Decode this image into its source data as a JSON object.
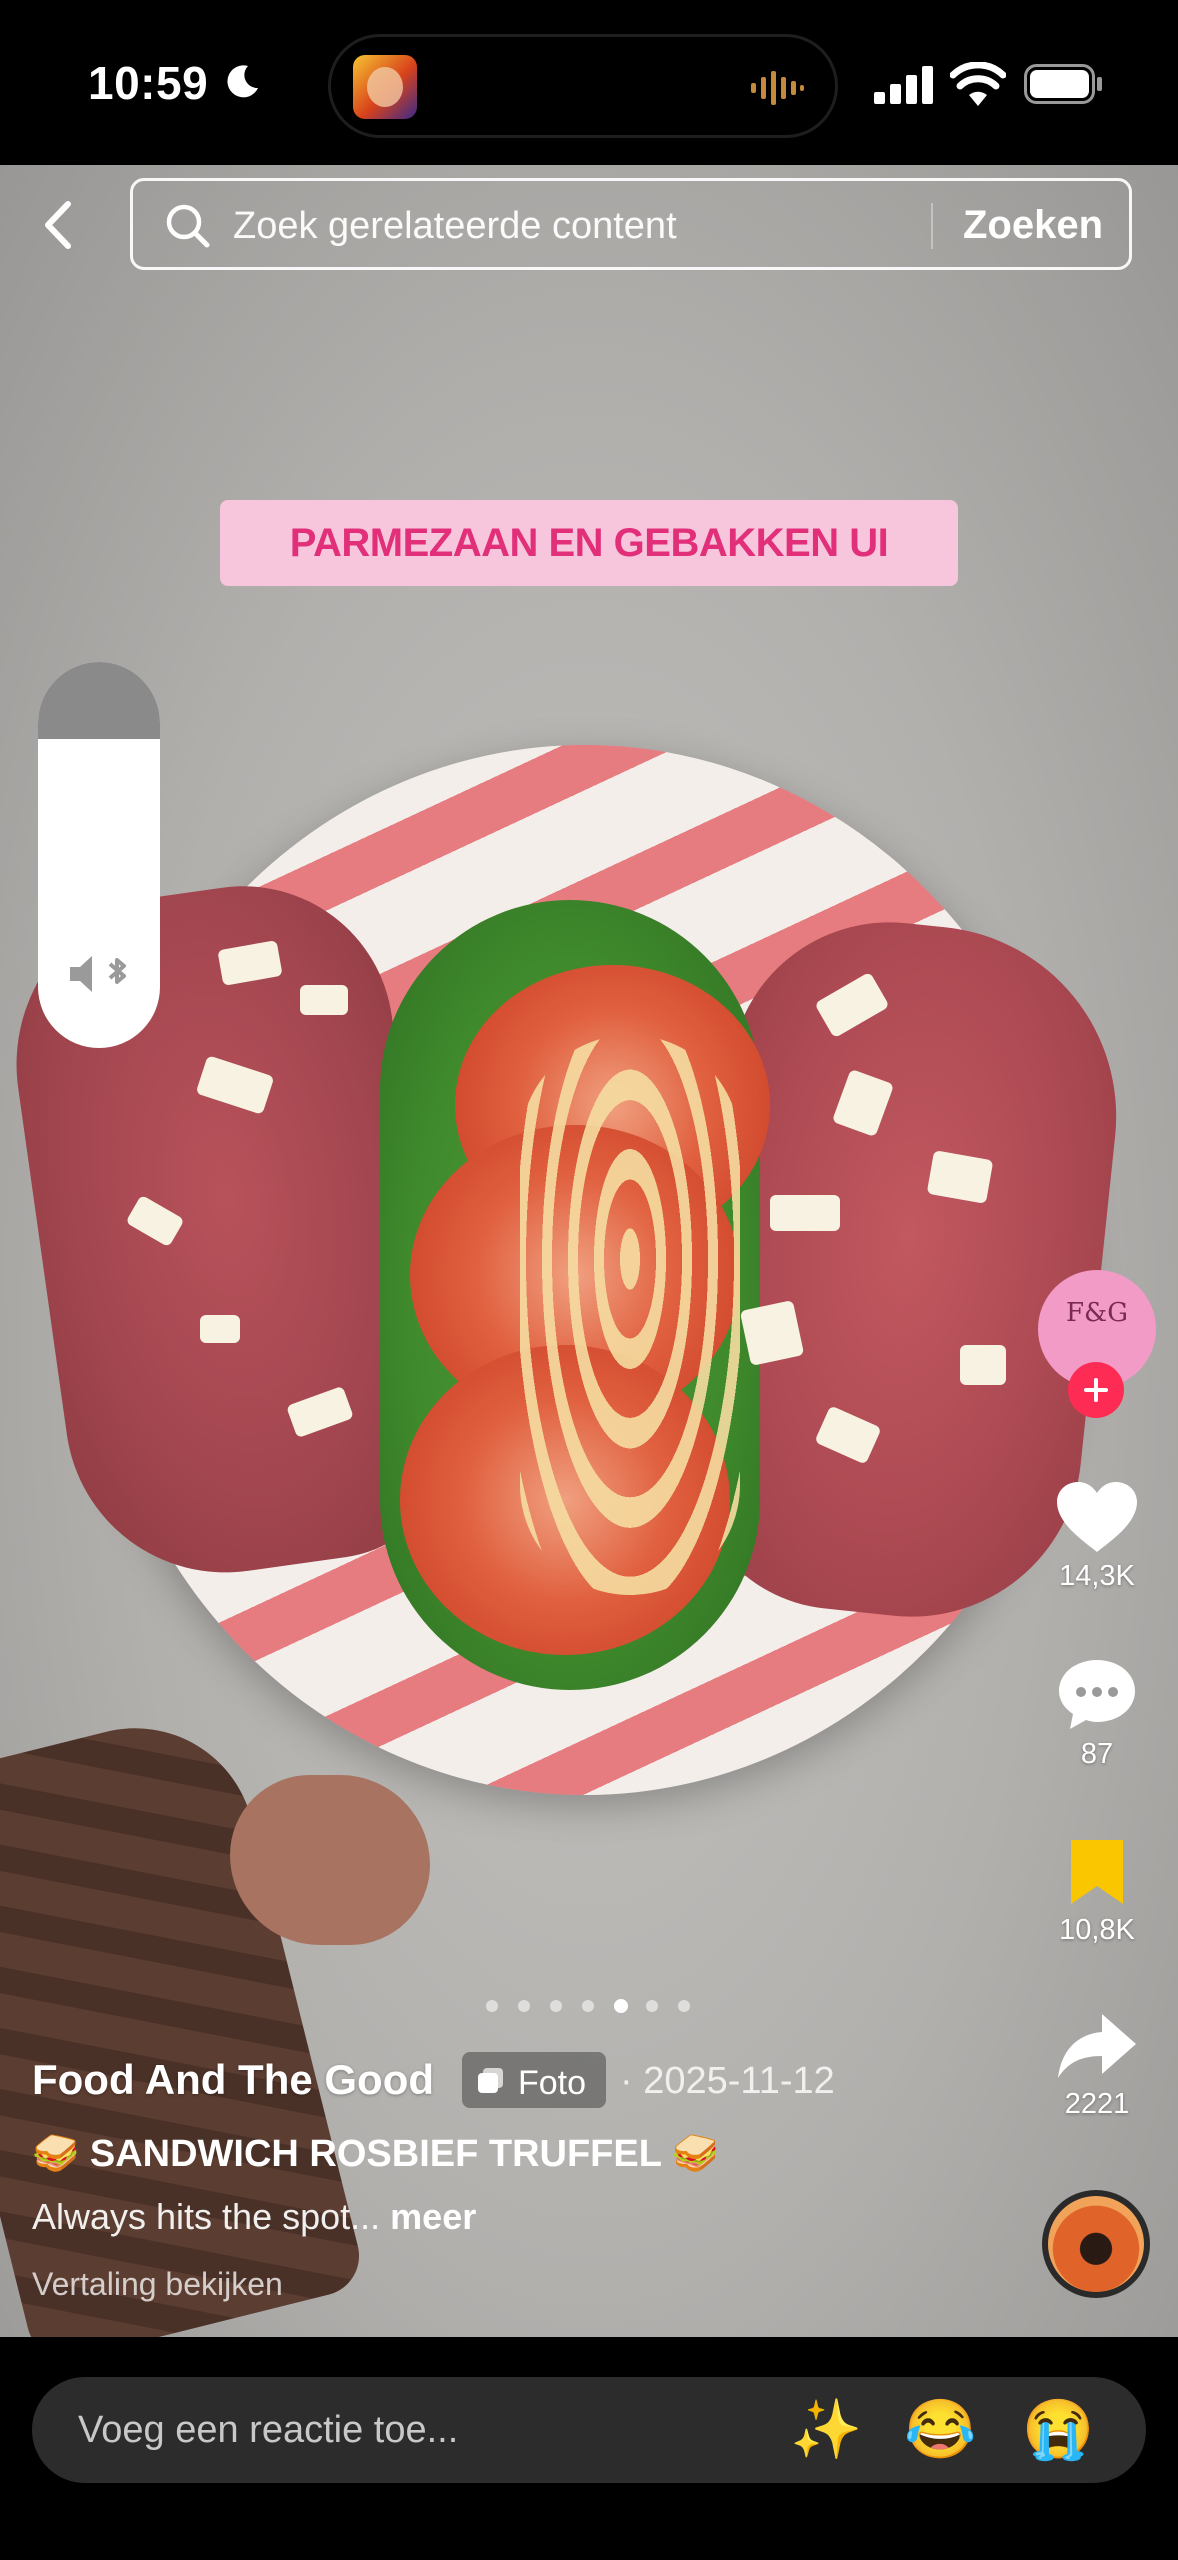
{
  "status_bar": {
    "time": "10:59"
  },
  "search": {
    "placeholder": "Zoek gerelateerde content",
    "button_label": "Zoeken"
  },
  "overlay_label": "PARMEZAAN EN GEBAKKEN UI",
  "volume": {
    "level_percent": 80
  },
  "actions": {
    "likes": "14,3K",
    "comments": "87",
    "saves": "10,8K",
    "shares": "2221"
  },
  "carousel": {
    "count": 7,
    "active_index": 4
  },
  "post": {
    "author": "Food And The Good",
    "type_label": "Foto",
    "date": "· 2025-11-12",
    "title": "🥪 SANDWICH ROSBIEF TRUFFEL 🥪",
    "description": "Always hits the spot...",
    "more_label": "meer",
    "translate_label": "Vertaling bekijken"
  },
  "comment": {
    "placeholder": "Voeg een reactie toe...",
    "emojis": [
      "✨",
      "😂",
      "😭"
    ]
  },
  "colors": {
    "accent": "#fe2c55",
    "overlay_bg": "#f8c6dc",
    "overlay_text": "#e12f7a",
    "bookmark": "#f9c600"
  }
}
